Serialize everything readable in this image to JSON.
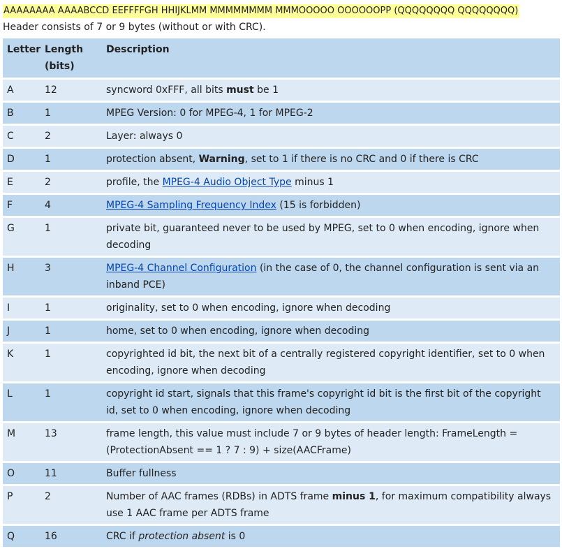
{
  "bit_layout": "AAAAAAAA AAAABCCD EEFFFFGH HHIJKLMM MMMMMMMM MMMOOOOO OOOOOOPP (QQQQQQQQ QQQQQQQQ)",
  "header_note": "Header consists of 7 or 9 bytes (without or with CRC).",
  "table": {
    "headers": {
      "letter": "Letter",
      "length": "Length (bits)",
      "description": "Description"
    },
    "rows": [
      {
        "letter": "A",
        "length": "12",
        "desc": [
          {
            "t": "syncword 0xFFF, all bits "
          },
          {
            "t": "must",
            "b": true
          },
          {
            "t": " be 1"
          }
        ]
      },
      {
        "letter": "B",
        "length": "1",
        "desc": [
          {
            "t": "MPEG Version: 0 for MPEG-4, 1 for MPEG-2"
          }
        ]
      },
      {
        "letter": "C",
        "length": "2",
        "desc": [
          {
            "t": "Layer: always 0"
          }
        ]
      },
      {
        "letter": "D",
        "length": "1",
        "desc": [
          {
            "t": "protection absent, "
          },
          {
            "t": "Warning",
            "b": true
          },
          {
            "t": ", set to 1 if there is no CRC and 0 if there is CRC"
          }
        ]
      },
      {
        "letter": "E",
        "length": "2",
        "desc": [
          {
            "t": "profile, the "
          },
          {
            "t": "MPEG-4 Audio Object Type",
            "link": true
          },
          {
            "t": " minus 1"
          }
        ]
      },
      {
        "letter": "F",
        "length": "4",
        "desc": [
          {
            "t": "MPEG-4 Sampling Frequency Index",
            "link": true
          },
          {
            "t": " (15 is forbidden)"
          }
        ]
      },
      {
        "letter": "G",
        "length": "1",
        "desc": [
          {
            "t": "private bit, guaranteed never to be used by MPEG, set to 0 when encoding, ignore when decoding"
          }
        ]
      },
      {
        "letter": "H",
        "length": "3",
        "desc": [
          {
            "t": "MPEG-4 Channel Configuration",
            "link": true
          },
          {
            "t": " (in the case of 0, the channel configuration is sent via an inband PCE)"
          }
        ]
      },
      {
        "letter": "I",
        "length": "1",
        "desc": [
          {
            "t": "originality, set to 0 when encoding, ignore when decoding"
          }
        ]
      },
      {
        "letter": "J",
        "length": "1",
        "desc": [
          {
            "t": "home, set to 0 when encoding, ignore when decoding"
          }
        ]
      },
      {
        "letter": "K",
        "length": "1",
        "desc": [
          {
            "t": "copyrighted id bit, the next bit of a centrally registered copyright identifier, set to 0 when encoding, ignore when decoding"
          }
        ]
      },
      {
        "letter": "L",
        "length": "1",
        "desc": [
          {
            "t": "copyright id start, signals that this frame's copyright id bit is the first bit of the copyright id, set to 0 when encoding, ignore when decoding"
          }
        ]
      },
      {
        "letter": "M",
        "length": "13",
        "desc": [
          {
            "t": "frame length, this value must include 7 or 9 bytes of header length: FrameLength = (ProtectionAbsent == 1 ? 7 : 9) + size(AACFrame)"
          }
        ]
      },
      {
        "letter": "O",
        "length": "11",
        "desc": [
          {
            "t": "Buffer fullness"
          }
        ]
      },
      {
        "letter": "P",
        "length": "2",
        "desc": [
          {
            "t": "Number of AAC frames (RDBs) in ADTS frame "
          },
          {
            "t": "minus 1",
            "b": true
          },
          {
            "t": ", for maximum compatibility always use 1 AAC frame per ADTS frame"
          }
        ]
      },
      {
        "letter": "Q",
        "length": "16",
        "desc": [
          {
            "t": "CRC if "
          },
          {
            "t": "protection absent",
            "i": true
          },
          {
            "t": " is 0"
          }
        ]
      }
    ]
  }
}
